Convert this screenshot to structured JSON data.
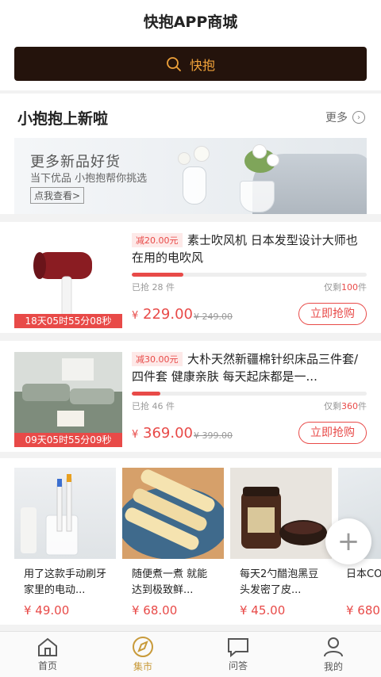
{
  "header": {
    "title": "快抱APP商城"
  },
  "search": {
    "label": "快抱"
  },
  "new_section": {
    "title": "小抱抱上新啦",
    "more_label": "更多",
    "banner": {
      "line1": "更多新品好货",
      "line2": "当下优品 小抱抱帮你挑选",
      "cta": "点我查看>"
    }
  },
  "products": [
    {
      "discount": "减20.00元",
      "name": "素士吹风机 日本发型设计大师也在用的电吹风",
      "sold": "已抢 28 件",
      "left_prefix": "仅剩",
      "left_count": "100",
      "left_suffix": "件",
      "progress": 0.22,
      "price_symbol": "¥",
      "price": "229.00",
      "original_price": "¥ 249.00",
      "countdown": "18天05时55分08秒",
      "buy_label": "立即抢购"
    },
    {
      "discount": "减30.00元",
      "name": "大朴天然新疆棉针织床品三件套/四件套 健康亲肤 每天起床都是一...",
      "sold": "已抢 46 件",
      "left_prefix": "仅剩",
      "left_count": "360",
      "left_suffix": "件",
      "progress": 0.12,
      "price_symbol": "¥",
      "price": "369.00",
      "original_price": "¥ 399.00",
      "countdown": "09天05时55分09秒",
      "buy_label": "立即抢购"
    }
  ],
  "cards": [
    {
      "name": "用了这款手动刷牙 家里的电动...",
      "price": "¥ 49.00"
    },
    {
      "name": "随便煮一煮 就能达到极致鲜...",
      "price": "¥ 68.00"
    },
    {
      "name": "每天2勺醋泡黑豆 头发密了皮...",
      "price": "¥ 45.00"
    },
    {
      "name": "日本CO赏TOP",
      "price": "¥ 680"
    }
  ],
  "tabs": [
    {
      "label": "首页",
      "icon": "home-icon"
    },
    {
      "label": "集市",
      "icon": "compass-icon",
      "active": true
    },
    {
      "label": "问答",
      "icon": "chat-icon"
    },
    {
      "label": "我的",
      "icon": "user-icon"
    }
  ],
  "colors": {
    "accent": "#e84a48",
    "brand_dark": "#24130c",
    "brand_gold": "#f0a23a",
    "tab_active": "#c89a3a"
  }
}
